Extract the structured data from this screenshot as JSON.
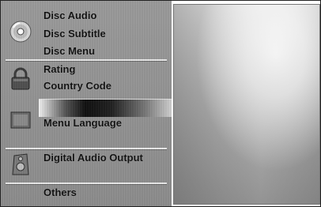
{
  "menu": {
    "groups": [
      {
        "icon": "disc-icon",
        "items": [
          "Disc Audio",
          "Disc Subtitle",
          "Disc Menu"
        ]
      },
      {
        "icon": "lock-icon",
        "items": [
          "Rating",
          "Country Code"
        ]
      },
      {
        "icon": "display-icon",
        "items": [
          "Menu Language"
        ]
      },
      {
        "icon": "speaker-icon",
        "items": [
          "Digital Audio Output"
        ]
      },
      {
        "icon": "",
        "items": [
          "Others"
        ]
      }
    ]
  },
  "colors": {
    "panel": "#8c8c8c",
    "text": "#111111",
    "divider": "#e8e8e8",
    "highlight": "#111111"
  }
}
